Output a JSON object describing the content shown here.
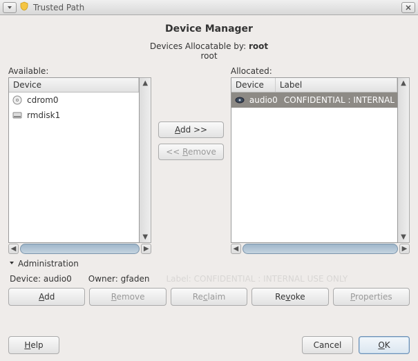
{
  "window": {
    "title": "Trusted Path"
  },
  "header": {
    "title": "Device Manager",
    "alloc_by_prefix": "Devices Allocatable by: ",
    "alloc_by_user": "root",
    "user_line": "root"
  },
  "available": {
    "label": "Available:",
    "columns": {
      "device": "Device"
    },
    "items": [
      {
        "icon": "cd-icon",
        "name": "cdrom0"
      },
      {
        "icon": "disk-icon",
        "name": "rmdisk1"
      }
    ]
  },
  "allocated": {
    "label": "Allocated:",
    "columns": {
      "device": "Device",
      "label": "Label"
    },
    "items": [
      {
        "icon": "audio-icon",
        "name": "audio0",
        "label": "CONFIDENTIAL : INTERNAL",
        "selected": true
      }
    ]
  },
  "transfer": {
    "add": "Add >>",
    "remove": "<< Remove"
  },
  "admin": {
    "section_label": "Administration",
    "device_prefix": "Device: ",
    "device_value": "audio0",
    "owner_prefix": "Owner: ",
    "owner_value": "gfaden",
    "label_prefix": "Label: ",
    "label_value": "CONFIDENTIAL : INTERNAL USE ONLY",
    "buttons": {
      "add": "Add",
      "remove": "Remove",
      "reclaim": "Reclaim",
      "revoke": "Revoke",
      "properties": "Properties"
    }
  },
  "footer": {
    "help": "Help",
    "cancel": "Cancel",
    "ok": "OK"
  }
}
